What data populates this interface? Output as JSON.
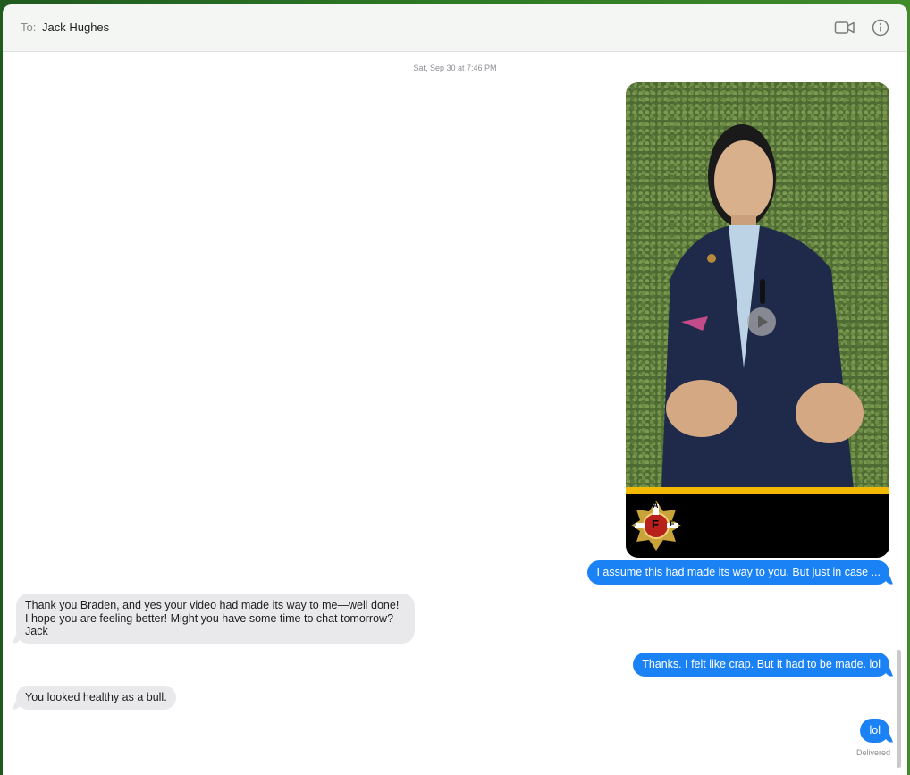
{
  "header": {
    "to_label": "To:",
    "recipient": "Jack Hughes",
    "icons": [
      "video-camera-icon",
      "info-icon"
    ]
  },
  "conversation": {
    "timestamp": "Sat, Sep 30 at 7:46 PM",
    "attachment": {
      "type": "video",
      "play_icon": "play-icon",
      "logo_letters": [
        "I",
        "A",
        "F",
        "F"
      ]
    },
    "messages": [
      {
        "from": "me",
        "text": "I assume this had made its way to you. But just in case ..."
      },
      {
        "from": "them",
        "text": "Thank you Braden, and yes your video had made its way to me—well done!\nI hope you are feeling better! Might you have some time to chat tomorrow?\nJack"
      },
      {
        "from": "me",
        "text": "Thanks. I felt like crap. But it had to be made. lol"
      },
      {
        "from": "them",
        "text": "You looked healthy as a bull."
      },
      {
        "from": "me",
        "text": "lol"
      }
    ],
    "status": "Delivered"
  },
  "colors": {
    "sent_bubble": "#1b82f5",
    "received_bubble": "#e9e9eb",
    "brand_gold": "#f2b900"
  }
}
